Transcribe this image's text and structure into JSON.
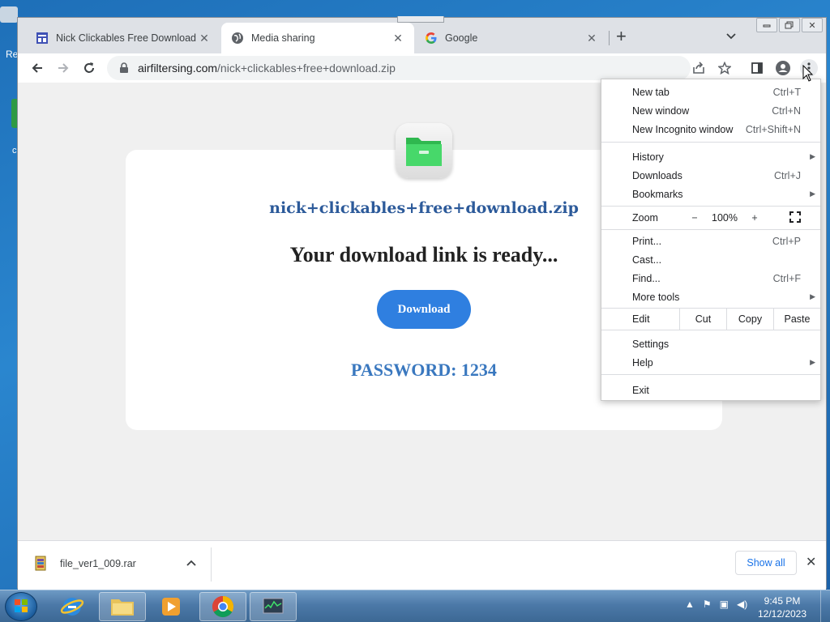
{
  "desktop": {
    "text_re": "Re",
    "text_c": "c"
  },
  "tabs": [
    {
      "label": "Nick Clickables Free Download",
      "icon": "page-icon"
    },
    {
      "label": "Media sharing",
      "icon": "globe-icon"
    },
    {
      "label": "Google",
      "icon": "google-icon"
    }
  ],
  "tab_close": "✕",
  "new_tab": "+",
  "tab_dropdown": "⌄",
  "window_controls": {
    "minimize": "▭",
    "restore": "❐",
    "close": "✕"
  },
  "address": {
    "host": "airfiltersing.com",
    "path": "/nick+clickables+free+download.zip"
  },
  "page": {
    "filename": "nick+clickables+free+download.zip",
    "headline": "Your download link is ready...",
    "download_label": "Download",
    "password": "PASSWORD: 1234"
  },
  "menu": {
    "items": [
      {
        "label": "New tab",
        "shortcut": "Ctrl+T"
      },
      {
        "label": "New window",
        "shortcut": "Ctrl+N"
      },
      {
        "label": "New Incognito window",
        "shortcut": "Ctrl+Shift+N"
      },
      {
        "label": "History",
        "shortcut": ""
      },
      {
        "label": "Downloads",
        "shortcut": "Ctrl+J"
      },
      {
        "label": "Bookmarks",
        "shortcut": ""
      },
      {
        "label": "Print...",
        "shortcut": "Ctrl+P"
      },
      {
        "label": "Cast...",
        "shortcut": ""
      },
      {
        "label": "Find...",
        "shortcut": "Ctrl+F"
      },
      {
        "label": "More tools",
        "shortcut": ""
      },
      {
        "label": "Settings",
        "shortcut": ""
      },
      {
        "label": "Help",
        "shortcut": ""
      },
      {
        "label": "Exit",
        "shortcut": ""
      }
    ],
    "zoom": {
      "label": "Zoom",
      "minus": "−",
      "value": "100%",
      "plus": "+"
    },
    "edit": {
      "label": "Edit",
      "cut": "Cut",
      "copy": "Copy",
      "paste": "Paste"
    }
  },
  "download_bar": {
    "file": "file_ver1_009.rar",
    "show_all": "Show all"
  },
  "taskbar": {
    "time": "9:45 PM",
    "date": "12/12/2023"
  },
  "colors": {
    "accent": "#2f7fe0",
    "filename": "#2c5a9a",
    "password": "#3a78bf"
  }
}
